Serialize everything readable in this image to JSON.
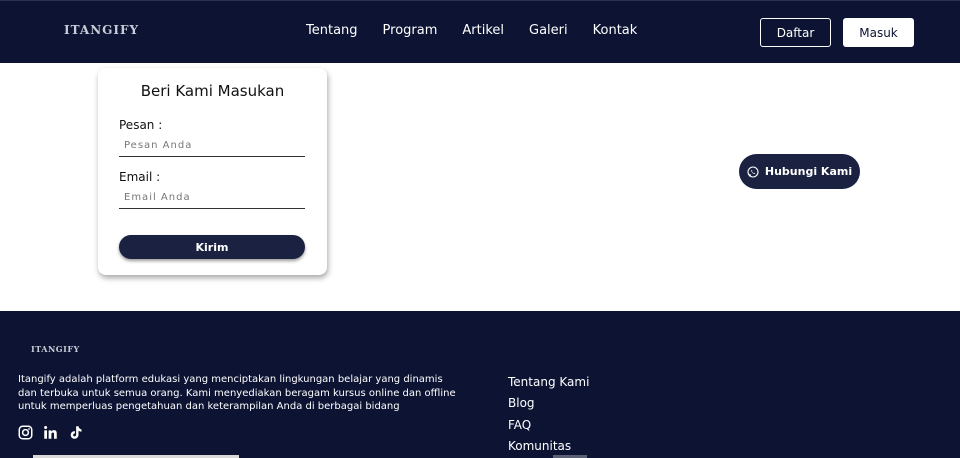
{
  "header": {
    "logo": "ITANGIFY",
    "nav": [
      {
        "label": "Tentang"
      },
      {
        "label": "Program"
      },
      {
        "label": "Artikel"
      },
      {
        "label": "Galeri"
      },
      {
        "label": "Kontak"
      }
    ],
    "register_label": "Daftar",
    "login_label": "Masuk"
  },
  "feedback": {
    "title": "Beri Kami Masukan",
    "message_label": "Pesan :",
    "message_placeholder": "Pesan Anda",
    "email_label": "Email :",
    "email_placeholder": "Email Anda",
    "submit_label": "Kirim"
  },
  "contact": {
    "label": "Hubungi Kami",
    "icon": "whatsapp-icon"
  },
  "footer": {
    "logo": "ITANGIFY",
    "description": "Itangify adalah platform edukasi yang menciptakan lingkungan belajar yang dinamis dan terbuka untuk semua orang. Kami menyediakan beragam kursus online dan offline untuk memperluas pengetahuan dan keterampilan Anda di berbagai bidang",
    "socials": [
      "instagram-icon",
      "linkedin-icon",
      "tiktok-icon"
    ],
    "links": [
      {
        "label": "Tentang Kami"
      },
      {
        "label": "Blog"
      },
      {
        "label": "FAQ"
      },
      {
        "label": "Komunitas"
      }
    ]
  },
  "colors": {
    "navy": "#0c1333",
    "button_dark": "#1b2140",
    "white": "#ffffff"
  }
}
